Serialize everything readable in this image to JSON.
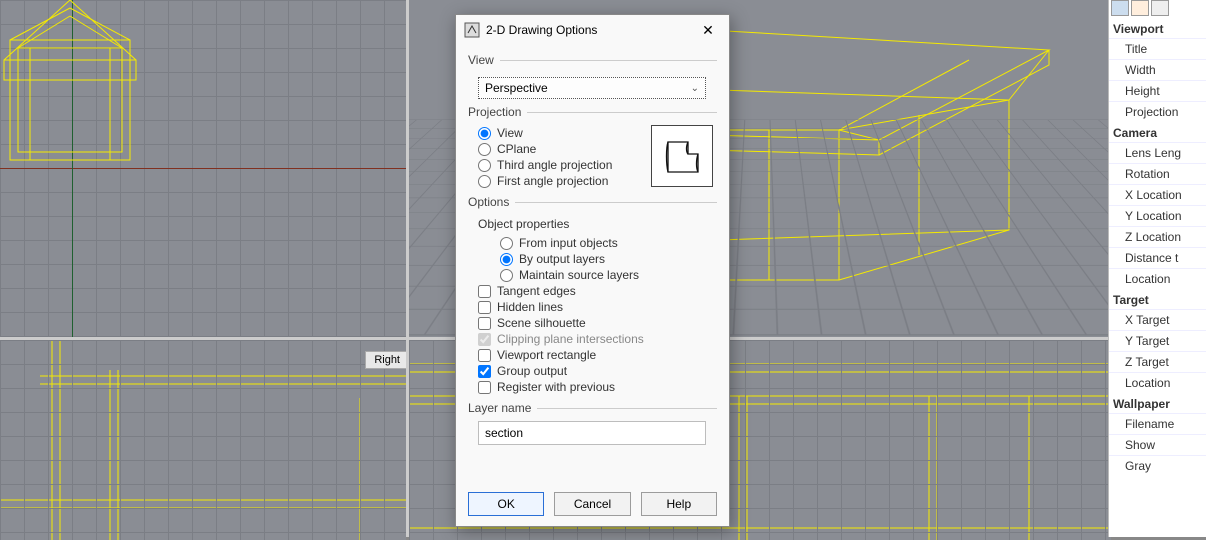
{
  "viewports": {
    "bottom_right_label": "Right"
  },
  "dialog": {
    "title": "2-D Drawing Options",
    "close_glyph": "✕",
    "groups": {
      "view": "View",
      "projection": "Projection",
      "options": "Options",
      "layer_name": "Layer name"
    },
    "view_combo": {
      "selected": "Perspective",
      "arrow": "⌄"
    },
    "projection": {
      "view": "View",
      "cplane": "CPlane",
      "third": "Third angle projection",
      "first": "First angle projection",
      "selected": "view"
    },
    "options": {
      "obj_props_label": "Object properties",
      "obj_props": {
        "from_input": "From input objects",
        "by_output": "By output layers",
        "maintain": "Maintain source layers",
        "selected": "by_output"
      },
      "tangent": "Tangent edges",
      "hidden": "Hidden lines",
      "silhouette": "Scene silhouette",
      "clipping": "Clipping plane intersections",
      "viewport_rect": "Viewport rectangle",
      "group_output": "Group output",
      "register": "Register with previous",
      "checked": [
        "clipping",
        "group_output"
      ],
      "disabled": [
        "clipping"
      ]
    },
    "layer_name_value": "section",
    "buttons": {
      "ok": "OK",
      "cancel": "Cancel",
      "help": "Help"
    }
  },
  "side_panel": {
    "sections": [
      {
        "header": "Viewport",
        "rows": [
          "Title",
          "Width",
          "Height",
          "Projection"
        ]
      },
      {
        "header": "Camera",
        "rows": [
          "Lens Leng",
          "Rotation",
          "X Location",
          "Y Location",
          "Z Location",
          "Distance t",
          "Location"
        ]
      },
      {
        "header": "Target",
        "rows": [
          "X Target",
          "Y Target",
          "Z Target",
          "Location"
        ]
      },
      {
        "header": "Wallpaper",
        "rows": [
          "Filename",
          "Show",
          "Gray"
        ]
      }
    ]
  }
}
